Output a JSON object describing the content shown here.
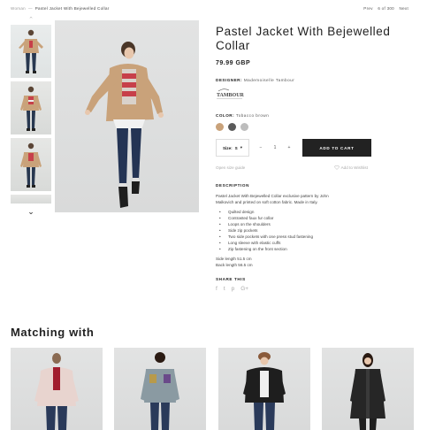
{
  "breadcrumb": {
    "parent": "Woman",
    "separator": "—",
    "current": "Pastel Jacket With Bejewelled Collar"
  },
  "pager": {
    "prev": "Prev",
    "position": "6 of 300",
    "next": "Next"
  },
  "gallery": {
    "up_arrow": "⌃",
    "down_arrow": "⌄"
  },
  "product": {
    "title": "Pastel Jacket With Bejewelled Collar",
    "price": "79.99 GBP",
    "designer_label": "DESIGNER:",
    "designer_name": "Mademoiselle Tambour",
    "brand_logo_text": "TAMBOUR",
    "color_label": "COLOR:",
    "color_name": "Tobacco brown",
    "swatches": [
      "#c9a27a",
      "#5a5a5a",
      "#bdbdbd"
    ],
    "size_label": "Size:",
    "size_value": "S",
    "size_caret": "▾",
    "qty_minus": "−",
    "qty_value": "1",
    "qty_plus": "+",
    "add_to_cart": "ADD TO CART",
    "size_guide": "Open size guide",
    "wishlist": "Add to Wishlist",
    "description_heading": "DESCRIPTION",
    "description": "Pastel Jacket With Bejewelled Collar exclusive pattern by John Malkovich and printed on soft cotton fabric. Made in Italy.",
    "features": [
      "Quilted design",
      "Contrasted faux fur collar",
      "Loops on the shoulders",
      "Side zip pockets",
      "Two side pockets with one press stud fastening",
      "Long sleeve with elastic cuffs",
      "Zip fastening on the front section"
    ],
    "side_length": "Side length 51.5 cm",
    "back_length": "Back length 56.5 cm",
    "share_heading": "SHARE THIS",
    "share_icons": [
      "f",
      "t",
      "p",
      "G+"
    ]
  },
  "matching": {
    "title": "Matching with"
  },
  "colors": {
    "accent": "#222222",
    "muted": "#aaaaaa"
  }
}
